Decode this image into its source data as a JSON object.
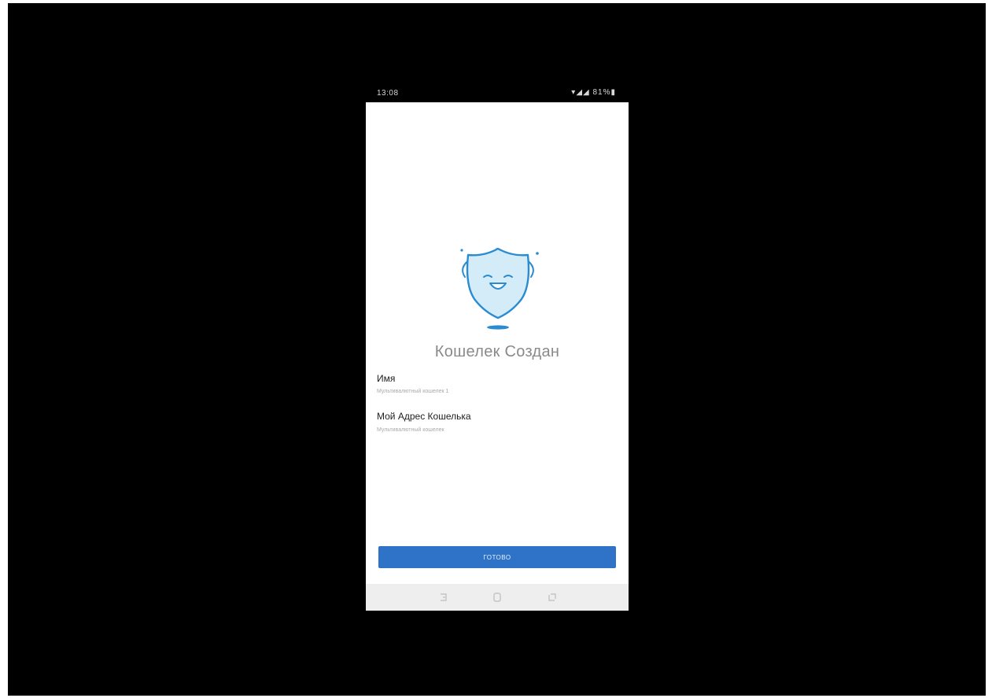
{
  "status_bar": {
    "time": "13:08",
    "icons": "▾◢◢ 81%▮"
  },
  "wallet_created": {
    "title": "Кошелек Создан",
    "name_label": "Имя",
    "name_value": "Мультивалютный кошелек 1",
    "address_label": "Мой Адрес Кошелька",
    "address_value": "Мультивалютный кошелек",
    "done_button_label": "ГОТОВО"
  },
  "colors": {
    "button": "#2f73c9",
    "mascot_stroke": "#2a8bd1",
    "mascot_fill": "#cfeaf7",
    "screen_background": "#ffffff",
    "nav_background": "#eeeeee"
  },
  "icons": {
    "mascot": "smiling-shield-icon",
    "nav_back": "back-nav-icon",
    "nav_home": "home-nav-icon",
    "nav_recent": "recent-apps-icon"
  }
}
